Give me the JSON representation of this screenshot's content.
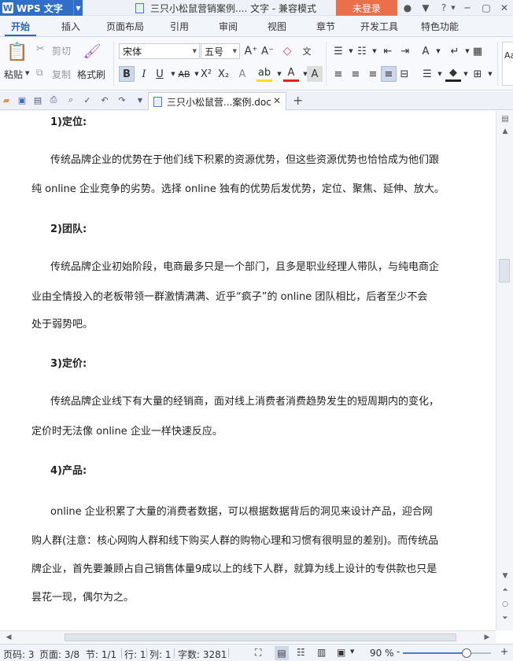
{
  "titlebar": {
    "app_menu_label": "WPS 文字",
    "window_title": "三只小松鼠营销案例.... 文字 - 兼容模式",
    "login_label": "未登录"
  },
  "menu_tabs": [
    "开始",
    "插入",
    "页面布局",
    "引用",
    "审阅",
    "视图",
    "章节",
    "开发工具",
    "特色功能"
  ],
  "ribbon": {
    "paste_label": "粘贴",
    "cut_label": "剪切",
    "copy_label": "复制",
    "format_painter_label": "格式刷",
    "font_name": "宋体",
    "font_size": "五号",
    "styles_preview": "Aa"
  },
  "doc_tab": {
    "label": "三只小松鼠营...案例.doc"
  },
  "document": {
    "lines": [
      {
        "text": "1)定位:",
        "heading": true
      },
      {
        "text": "传统品牌企业的优势在于他们线下积累的资源优势，但这些资源优势也恰恰成为他们跟",
        "heading": false
      },
      {
        "text": "纯 online 企业竞争的劣势。选择 online 独有的优势后发优势，定位、聚焦、延伸、放大。",
        "heading": false
      },
      {
        "text": "2)团队:",
        "heading": true
      },
      {
        "text": "传统品牌企业初始阶段，电商最多只是一个部门，且多是职业经理人带队，与纯电商企",
        "heading": false
      },
      {
        "text": "业由全情投入的老板带领一群激情满满、近乎“疯子”的 online 团队相比，后者至少不会",
        "heading": false
      },
      {
        "text": "处于弱势吧。",
        "heading": false
      },
      {
        "text": "3)定价:",
        "heading": true
      },
      {
        "text": "传统品牌企业线下有大量的经销商，面对线上消费者消费趋势发生的短周期内的变化，",
        "heading": false
      },
      {
        "text": "定价时无法像 online 企业一样快速反应。",
        "heading": false
      },
      {
        "text": "4)产品:",
        "heading": true
      },
      {
        "text": "online 企业积累了大量的消费者数据，可以根据数据背后的洞见来设计产品，迎合网",
        "heading": false
      },
      {
        "text": "购人群(注意：核心网购人群和线下购买人群的购物心理和习惯有很明显的差别)。而传统品",
        "heading": false
      },
      {
        "text": "牌企业，首先要兼顾占自己销售体量9成以上的线下人群，就算为线上设计的专供款也只是",
        "heading": false
      },
      {
        "text": "昙花一现，偶尔为之。",
        "heading": false
      }
    ]
  },
  "statusbar": {
    "page_num": "页码: 3",
    "page_of": "页面: 3/8",
    "section": "节: 1/1",
    "row": "行: 1",
    "col": "列: 1",
    "word_count": "字数: 3281",
    "zoom": "90 %",
    "zoom_level": 0.72
  }
}
